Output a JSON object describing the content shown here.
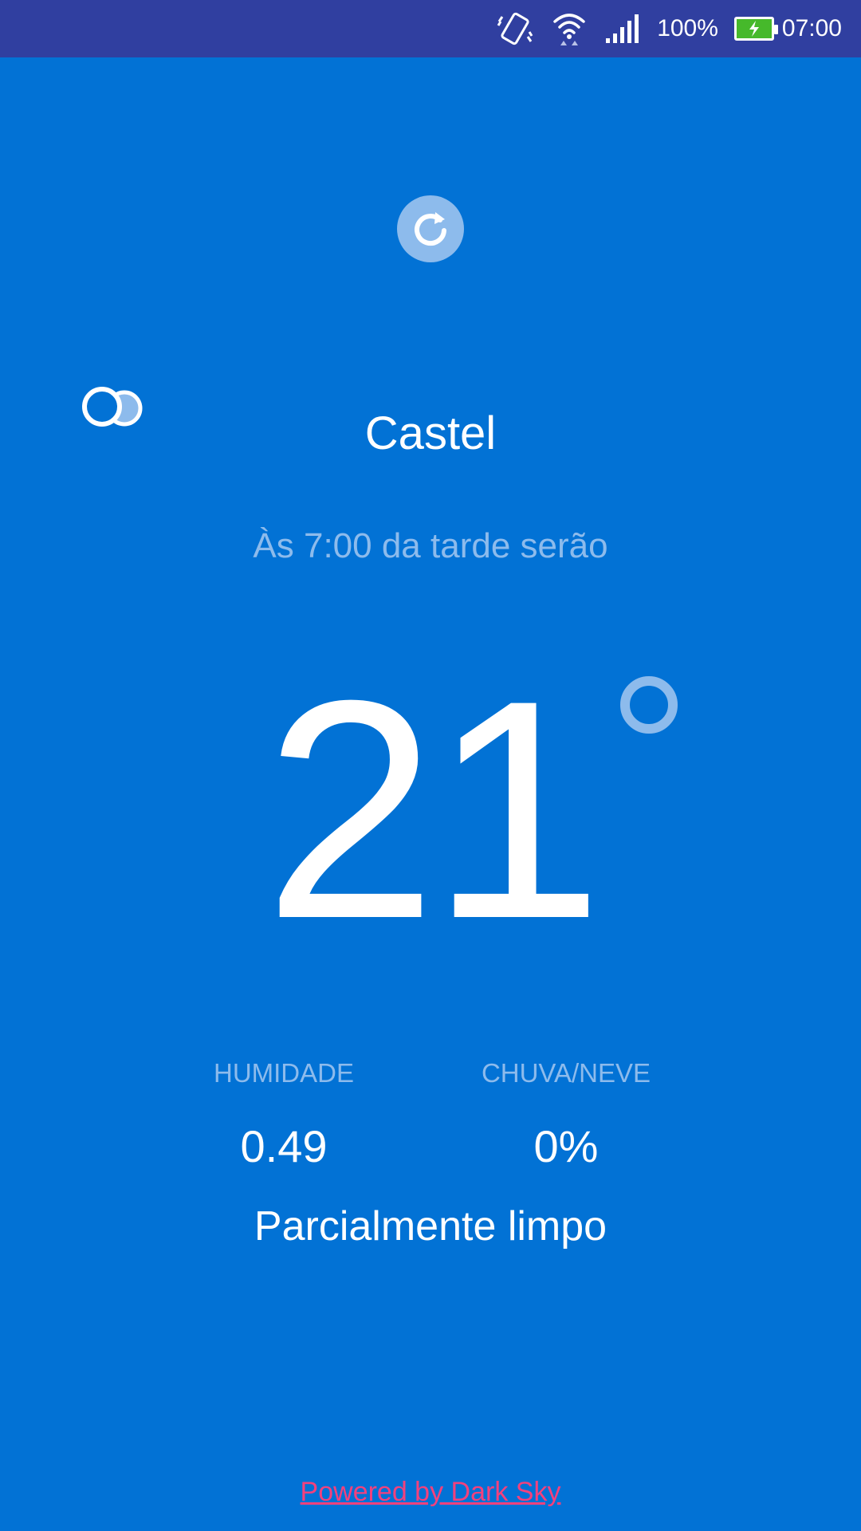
{
  "status_bar": {
    "battery_percent": "100%",
    "time": "07:00",
    "icons": [
      "vibrate-icon",
      "wifi-icon",
      "signal-icon",
      "battery-charging-icon"
    ],
    "battery_color": "#46b92b"
  },
  "weather": {
    "city": "Castel",
    "subtitle": "Às 7:00 da tarde serão",
    "temperature": "21",
    "condition_icon": "partly-cloudy-icon",
    "summary": "Parcialmente limpo"
  },
  "stats": {
    "humidity_label": "HUMIDADE",
    "humidity_value": "0.49",
    "precip_label": "CHUVA/NEVE",
    "precip_value": "0%"
  },
  "footer": {
    "powered_by": "Powered by Dark Sky"
  },
  "colors": {
    "background": "#0272d5",
    "status_bar": "#303fa0",
    "accent_light": "#8dbbec",
    "link": "#f2417d"
  }
}
